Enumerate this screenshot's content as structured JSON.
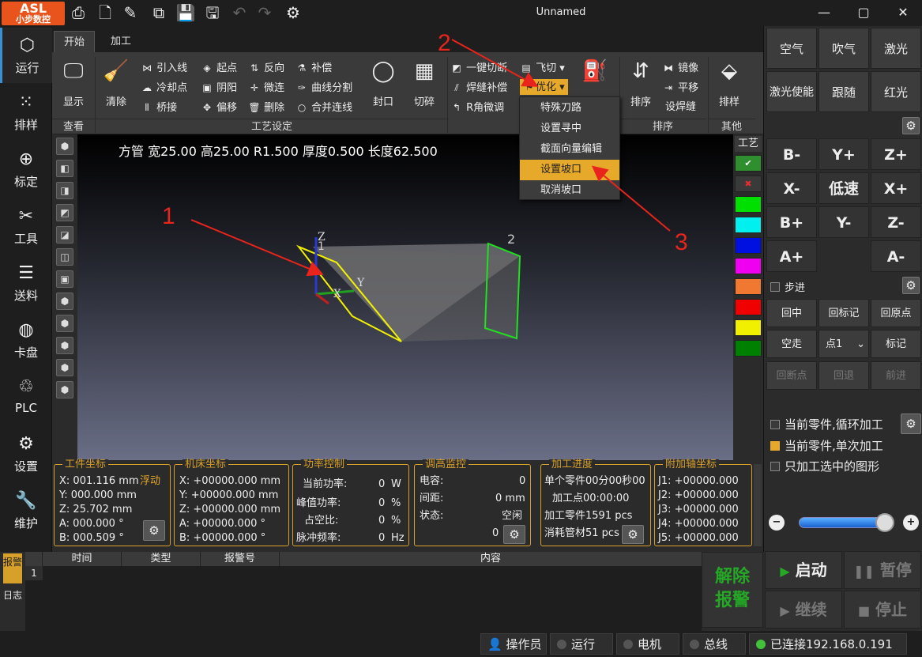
{
  "titlebar": {
    "logo_text": "ASL",
    "logo_sub": "小步数控",
    "title": "Unnamed",
    "minimize": "—",
    "maximize": "▢",
    "close": "✕"
  },
  "ribbon_tabs": [
    "开始",
    "加工"
  ],
  "leftnav": [
    {
      "label": "运行",
      "icon": "cube-icon"
    },
    {
      "label": "排样",
      "icon": "grid-circles-icon"
    },
    {
      "label": "标定",
      "icon": "crosshair-icon"
    },
    {
      "label": "工具",
      "icon": "wrench-icon"
    },
    {
      "label": "送料",
      "icon": "feed-icon"
    },
    {
      "label": "卡盘",
      "icon": "chuck-icon"
    },
    {
      "label": "PLC",
      "icon": "plc-icon"
    },
    {
      "label": "设置",
      "icon": "gear-icon"
    },
    {
      "label": "维护",
      "icon": "maintenance-icon"
    }
  ],
  "ribbon": {
    "view": {
      "display": "显示",
      "group": "查看"
    },
    "process": {
      "clear": "清除",
      "lead_in": "引入线",
      "cool_point": "冷却点",
      "bridge": "桥接",
      "start_point": "起点",
      "yin_yang": "阴阳",
      "offset": "偏移",
      "reverse": "反向",
      "micro_joint": "微连",
      "delete": "删除",
      "compensate": "补偿",
      "curve_split": "曲线分割",
      "merge_lines": "合并连线",
      "seal": "封口",
      "shred": "切碎",
      "group": "工艺设定"
    },
    "optimize": {
      "one_click_cut": "一键切断",
      "fly_cut": "飞切",
      "weld_comp": "焊缝补偿",
      "optimize": "优化",
      "r_corner": "R角微调"
    },
    "sort": {
      "sort": "排序",
      "mirror": "镜像",
      "translate": "平移",
      "set_weld": "设焊缝",
      "group": "排序"
    },
    "other": {
      "layout": "排样",
      "group": "其他"
    }
  },
  "dropdown": [
    "特殊刀路",
    "设置寻中",
    "截面向量编辑",
    "设置坡口",
    "取消坡口"
  ],
  "viewport": {
    "part_info": "方管 宽25.00 高25.00 R1.500 厚度0.500 长度62.500",
    "axis_labels": [
      "Z",
      "Y",
      "X"
    ],
    "end_labels": [
      "1",
      "2"
    ]
  },
  "palette": {
    "header": "工艺",
    "colors": [
      "#2f8f2f",
      "#c03030",
      "#00e000",
      "#00f0f0",
      "#0010e0",
      "#f000f0",
      "#f07830",
      "#f00000",
      "#f0f000",
      "#008000"
    ],
    "check": "✔",
    "cross": "✖"
  },
  "right": {
    "top_buttons": [
      "空气",
      "吹气",
      "激光",
      "激光使能",
      "跟随",
      "红光"
    ],
    "jog": [
      "B-",
      "Y+",
      "Z+",
      "X-",
      "低速",
      "X+",
      "B+",
      "Y-",
      "Z-",
      "A+",
      "A-"
    ],
    "step": "步进",
    "home": [
      "回中",
      "回标记",
      "回原点"
    ],
    "travel": "空走",
    "point": "点1",
    "mark": "标记",
    "break": [
      "回断点",
      "回退",
      "前进"
    ],
    "options": [
      "当前零件,循环加工",
      "当前零件,单次加工",
      "只加工选中的图形"
    ],
    "slider_value": 0.88
  },
  "panels": {
    "work": {
      "title": "工件坐标",
      "float": "浮动",
      "lines": [
        "X: 001.116 mm",
        "Y: 000.000 mm",
        "Z:  25.702 mm",
        "A: 000.000 °",
        "B: 000.509 °"
      ]
    },
    "machine": {
      "title": "机床坐标",
      "lines": [
        "X: +00000.000 mm",
        "Y: +00000.000 mm",
        "Z: +00000.000 mm",
        "A: +00000.000 °",
        "B: +00000.000 °"
      ]
    },
    "power": {
      "title": "功率控制",
      "rows": [
        [
          "当前功率:",
          "0",
          "W"
        ],
        [
          "峰值功率:",
          "0",
          "%"
        ],
        [
          "占空比:",
          "0",
          "%"
        ],
        [
          "脉冲频率:",
          "0",
          "Hz"
        ]
      ]
    },
    "height": {
      "title": "调高监控",
      "rows": [
        [
          "电容:",
          "0"
        ],
        [
          "间距:",
          "0 mm"
        ],
        [
          "状态:",
          "空闲"
        ]
      ],
      "value": "0"
    },
    "progress": {
      "title": "加工进度",
      "lines": [
        "单个零件00分00秒00",
        "加工点00:00:00",
        "加工零件1591 pcs",
        "消耗管材51 pcs"
      ]
    },
    "aux": {
      "title": "附加轴坐标",
      "lines": [
        "J1: +00000.000",
        "J2: +00000.000",
        "J3: +00000.000",
        "J4: +00000.000",
        "J5: +00000.000"
      ]
    }
  },
  "log": {
    "tabs": [
      "报警",
      "日志"
    ],
    "columns": [
      "时间",
      "类型",
      "报警号",
      "内容"
    ],
    "row_no": "1"
  },
  "actions": {
    "clear_alarm": [
      "解除",
      "报警"
    ],
    "start": "启动",
    "pause": "暂停",
    "continue": "继续",
    "stop": "停止"
  },
  "status": {
    "operator": "操作员",
    "run": "运行",
    "motor": "电机",
    "bus": "总线",
    "connected": "已连接192.168.0.191"
  },
  "annotations": [
    "1",
    "2",
    "3"
  ],
  "colors": {
    "accent": "#e6a92a",
    "arrow": "#e8241c",
    "green": "#25a825"
  }
}
